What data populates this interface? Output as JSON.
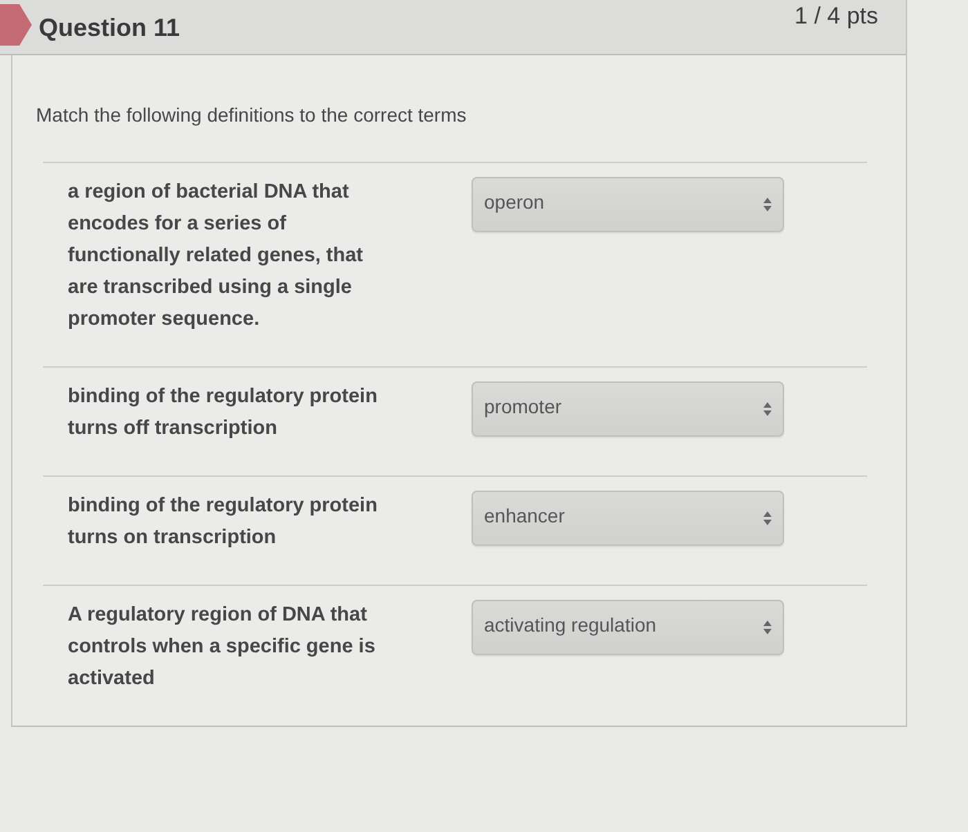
{
  "question": {
    "title": "Question 11",
    "points": "1 / 4 pts",
    "flagged": true
  },
  "prompt": "Match the following definitions to the correct terms",
  "matches": [
    {
      "definition": "a region of bacterial DNA that encodes for a series of functionally related genes, that are transcribed using a single promoter sequence.",
      "answer": "operon"
    },
    {
      "definition": "binding of the regulatory protein turns off transcription",
      "answer": "promoter"
    },
    {
      "definition": "binding of the regulatory protein turns on transcription",
      "answer": "enhancer"
    },
    {
      "definition": "A regulatory region of DNA that controls when a specific gene is activated",
      "answer": "activating regulation"
    }
  ]
}
